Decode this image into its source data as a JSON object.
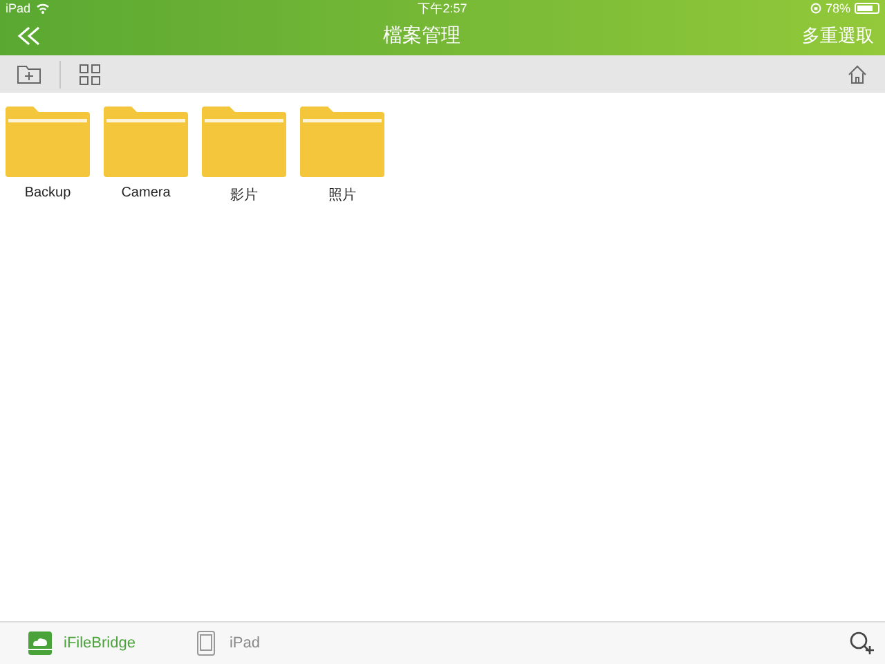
{
  "status_bar": {
    "device": "iPad",
    "time": "下午2:57",
    "battery": "78%"
  },
  "nav_bar": {
    "title": "檔案管理",
    "action": "多重選取"
  },
  "folders": [
    {
      "name": "Backup"
    },
    {
      "name": "Camera"
    },
    {
      "name": "影片"
    },
    {
      "name": "照片"
    }
  ],
  "tabs": [
    {
      "label": "iFileBridge",
      "kind": "cloud",
      "selected": true
    },
    {
      "label": "iPad",
      "kind": "device",
      "selected": false
    }
  ]
}
